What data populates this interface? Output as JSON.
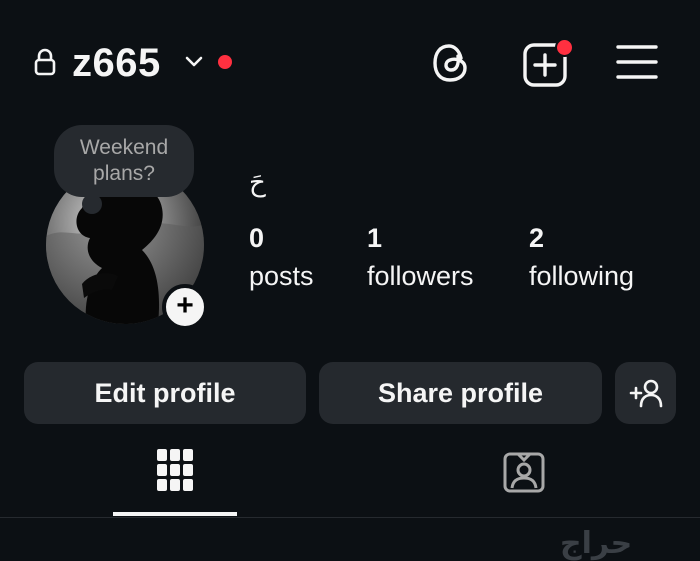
{
  "header": {
    "username": "z665",
    "icons": [
      "lock-icon",
      "chevron-down-icon",
      "threads-icon",
      "create-icon",
      "menu-icon"
    ]
  },
  "profile": {
    "note": "Weekend plans?",
    "full_name": "حَ",
    "stats": [
      {
        "num": "0",
        "label": "posts"
      },
      {
        "num": "1",
        "label": "followers"
      },
      {
        "num": "2",
        "label": "following"
      }
    ]
  },
  "actions": {
    "edit": "Edit profile",
    "share": "Share profile"
  },
  "tabs": [
    "grid",
    "tagged"
  ],
  "watermark": "حراج",
  "colors": {
    "background": "#0c1014",
    "notification": "#ff3040",
    "button": "#25292e"
  }
}
